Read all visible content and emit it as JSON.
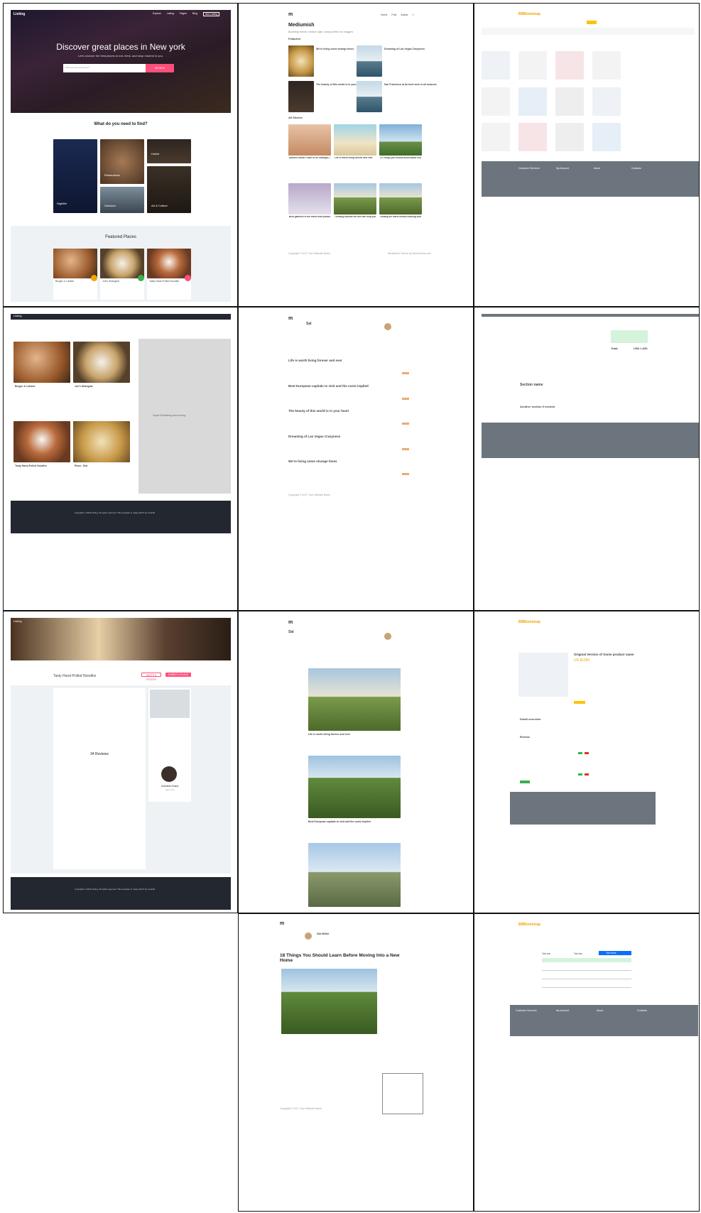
{
  "listing": {
    "brand": "Listing",
    "nav": [
      "Explore",
      "Listing",
      "Pages",
      "Blog",
      "Add Listing"
    ],
    "hero_title": "Discover great places in New york",
    "hero_sub": "Let's uncover the best places to eat, drink, and shop nearest to you.",
    "search_placeholder": "What are you looking for?",
    "search_button": "SEARCH",
    "what_title": "What do you need to find?",
    "categories": [
      "Nightlife",
      "Restaurants",
      "Hotels",
      "Outdoors",
      "Art & Culture"
    ],
    "featured_title": "Featured Places",
    "places": [
      "Burger & Lobster",
      "Joe's Shanghai",
      "Tasty Hand-Pulled Noodles",
      "Pizza - Dok"
    ],
    "results_label": "Oops! Something went wrong.",
    "footer": "Copyright © 2018 Listing. All rights reserved. This template is made with ♥ by Colorlib",
    "detail_title": "Tasty Hand-Pulled Noodles",
    "detail_write": "WRITE A REVIEW",
    "detail_submit": "SUBMIT A PLACE",
    "reviews_title": "34 Reviews",
    "reviewer": "Christine Evans",
    "reviewer_city": "New York"
  },
  "mediumish": {
    "logo": "m",
    "nav": [
      "Home",
      "Post",
      "Author"
    ],
    "title": "Mediumish",
    "subtitle": "Bootstrap theme, medium style, simply perfect for bloggers",
    "featured": "Featured",
    "all_stories": "All Stories",
    "featured_posts": [
      "We're living some strange times",
      "Dreaming of Las Vegas Crazyness",
      "The beauty of this world is in your heart",
      "San Francisco at its best view in all seasons"
    ],
    "stories": [
      "Autumn doesn't have to be nostalgic, you know?",
      "Life is worth living forever and ever",
      "10 Things you should know about choosing your house",
      "Best galleries in the world with photos",
      "Thinking outside the box can help you prosper",
      "Visiting the world means learning cultures"
    ],
    "list_posts": [
      "Life is worth living forever and ever",
      "Best European capitals to visit and the costs implied",
      "The beauty of this world is in your heart",
      "Dreaming of Las Vegas Crazyness",
      "We're living some strange times"
    ],
    "author": "Sal",
    "author_full": "Sal Miller",
    "article_title": "18 Things You Should Learn Before Moving Into a New Home",
    "copyright": "Copyright © 2017 Your Website Name",
    "designed": "Mediumish Theme by WowThemes.net"
  },
  "shop": {
    "brand": "BBBootstrap",
    "section": "Section name",
    "section2": "Another section if needed",
    "product_title": "Original Version of Some product name",
    "price": "US $1280",
    "detail_overview": "Detail overview",
    "reviews": "Reviews",
    "footer_cols": [
      "Customer Services",
      "My Account",
      "About",
      "Contacts"
    ],
    "total_label": "Total:",
    "total_value": "USD 1,650",
    "form_tabs": [
      "Tab one",
      "Tab two",
      "Tab three"
    ]
  },
  "colors": {
    "pink": "#ff4f7a",
    "green": "#37b24d",
    "dark": "#232730",
    "shop_yellow": "#ffc107",
    "shop_footer": "#6c757d",
    "blue": "#0d6efd"
  }
}
